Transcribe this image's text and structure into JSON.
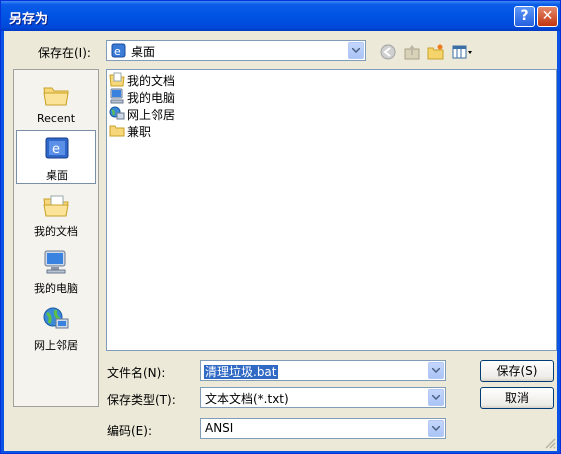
{
  "window": {
    "title": "另存为",
    "help_button": "?",
    "close_button": "✕"
  },
  "toolbar": {
    "save_in_label": "保存在(I):",
    "location": "桌面",
    "icons": [
      "back-icon",
      "up-folder-icon",
      "new-folder-icon",
      "view-menu-icon"
    ]
  },
  "places": [
    {
      "label": "Recent",
      "icon": "recent-folder-icon"
    },
    {
      "label": "桌面",
      "icon": "desktop-icon",
      "selected": true
    },
    {
      "label": "我的文档",
      "icon": "my-documents-icon"
    },
    {
      "label": "我的电脑",
      "icon": "my-computer-icon"
    },
    {
      "label": "网上邻居",
      "icon": "network-places-icon"
    }
  ],
  "files": [
    {
      "name": "我的文档",
      "icon": "my-documents-icon"
    },
    {
      "name": "我的电脑",
      "icon": "my-computer-icon"
    },
    {
      "name": "网上邻居",
      "icon": "network-places-icon"
    },
    {
      "name": "兼职",
      "icon": "folder-icon"
    }
  ],
  "form": {
    "filename_label": "文件名(N):",
    "filename_value": "清理垃圾.bat",
    "type_label": "保存类型(T):",
    "type_value": "文本文档(*.txt)",
    "encoding_label": "编码(E):",
    "encoding_value": "ANSI"
  },
  "buttons": {
    "save": "保存(S)",
    "cancel": "取消"
  },
  "colors": {
    "title_bar": "#0054e3",
    "client_bg": "#ece9d8",
    "selection": "#316ac5"
  }
}
